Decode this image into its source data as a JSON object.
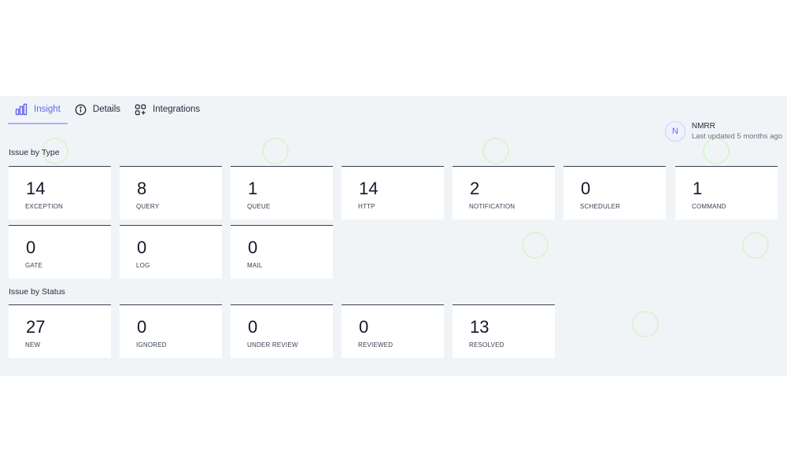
{
  "tabs": [
    {
      "label": "Insight",
      "icon": "bar-chart-icon",
      "active": true
    },
    {
      "label": "Details",
      "icon": "info-icon",
      "active": false
    },
    {
      "label": "Integrations",
      "icon": "grid-plus-icon",
      "active": false
    }
  ],
  "user": {
    "initial": "N",
    "name": "NMRR",
    "updated": "Last updated 5 months ago"
  },
  "issue_by_type": {
    "title": "Issue by Type",
    "cards": [
      {
        "value": "14",
        "label": "EXCEPTION"
      },
      {
        "value": "8",
        "label": "QUERY"
      },
      {
        "value": "1",
        "label": "QUEUE"
      },
      {
        "value": "14",
        "label": "HTTP"
      },
      {
        "value": "2",
        "label": "NOTIFICATION"
      },
      {
        "value": "0",
        "label": "SCHEDULER"
      },
      {
        "value": "1",
        "label": "COMMAND"
      },
      {
        "value": "0",
        "label": "GATE"
      },
      {
        "value": "0",
        "label": "LOG"
      },
      {
        "value": "0",
        "label": "MAIL"
      }
    ]
  },
  "issue_by_status": {
    "title": "Issue by Status",
    "cards": [
      {
        "value": "27",
        "label": "NEW"
      },
      {
        "value": "0",
        "label": "IGNORED"
      },
      {
        "value": "0",
        "label": "UNDER REVIEW"
      },
      {
        "value": "0",
        "label": "REVIEWED"
      },
      {
        "value": "13",
        "label": "RESOLVED"
      }
    ]
  },
  "colors": {
    "accent": "#6366f1",
    "panel_bg": "#f1f4f7",
    "card_border": "#374151"
  }
}
